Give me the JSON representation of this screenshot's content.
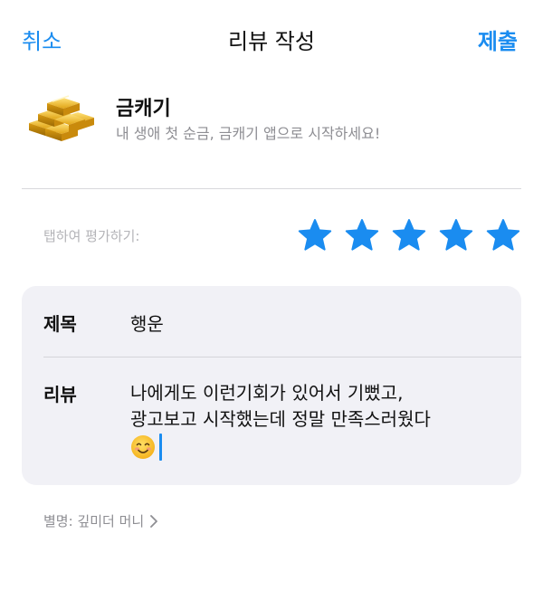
{
  "nav": {
    "cancel": "취소",
    "title": "리뷰 작성",
    "submit": "제출"
  },
  "app": {
    "name": "금캐기",
    "subtitle": "내 생애 첫 순금, 금캐기 앱으로 시작하세요!",
    "icon": "gold-bars-icon"
  },
  "rating": {
    "hint": "탭하여 평가하기:",
    "stars": 5,
    "max": 5,
    "color": "#1a8cf0"
  },
  "form": {
    "title_label": "제목",
    "title_value": "행운",
    "review_label": "리뷰",
    "review_lines": [
      "나에게도 이런기회가 있어서 기뻤고,",
      "광고보고 시작했는데 정말 만족스러웠다"
    ],
    "emoji": "smiling-face-icon"
  },
  "nickname": {
    "text": "별명: 깊미더 머니"
  },
  "colors": {
    "accent": "#1a8cf0",
    "field_bg": "#f1f1f6",
    "secondary_text": "#8e8e93"
  }
}
